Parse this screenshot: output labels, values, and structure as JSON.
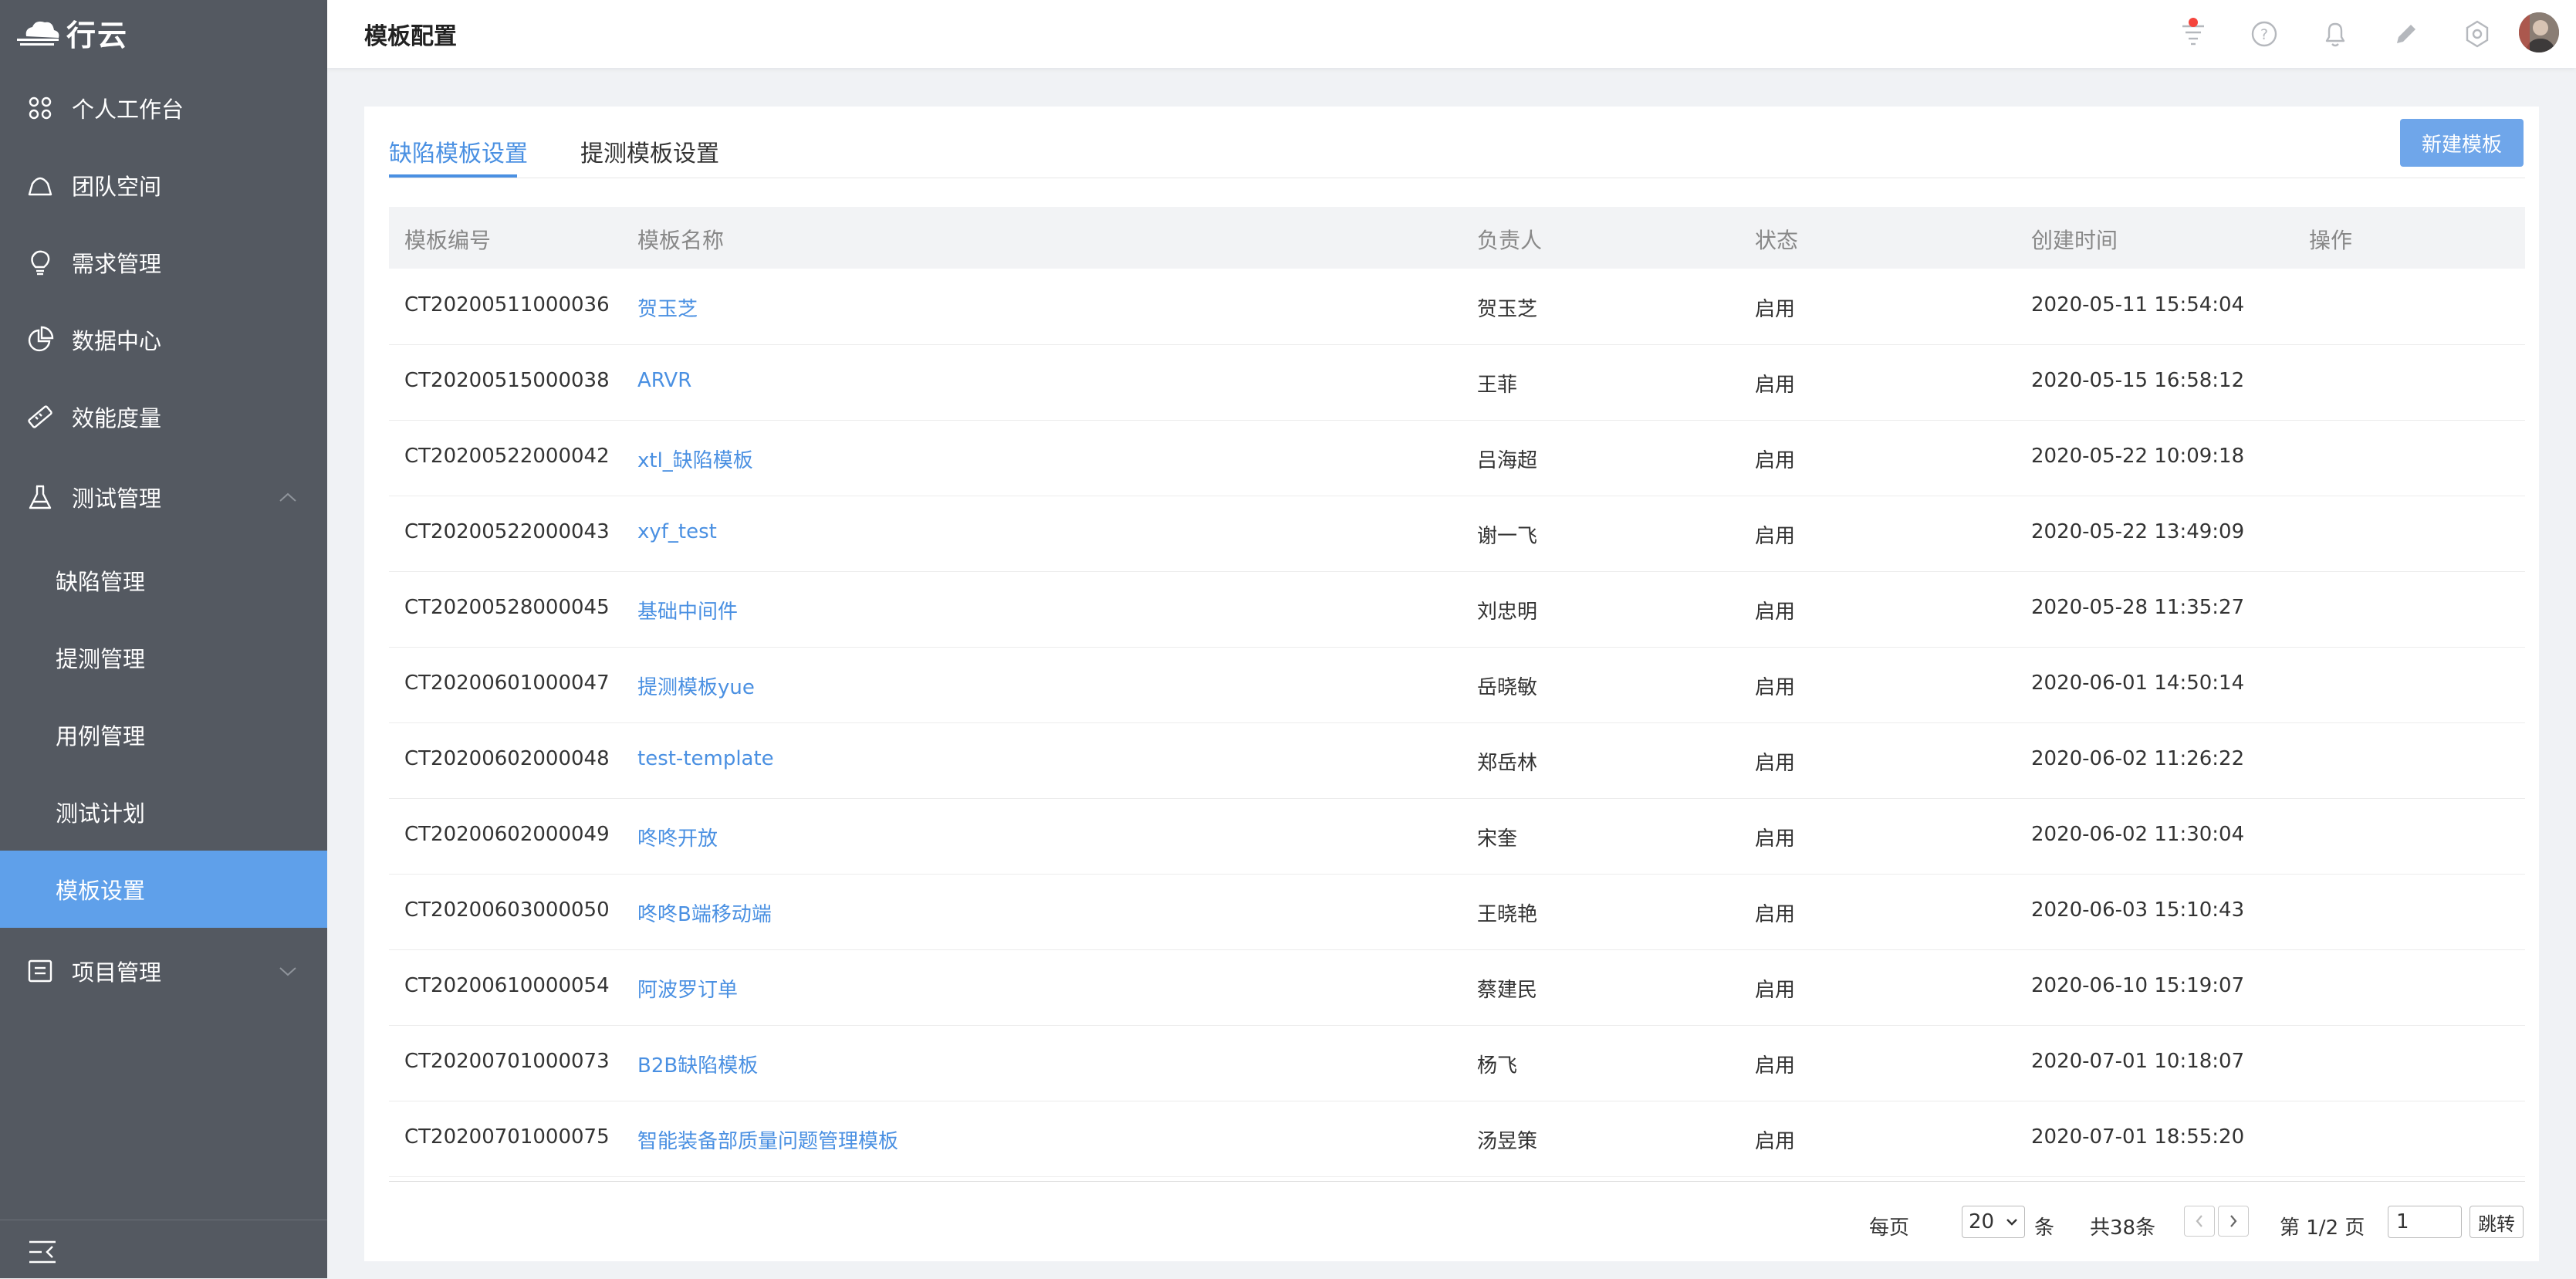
{
  "app": {
    "logo_text": "行云"
  },
  "sidebar": {
    "items": [
      {
        "label": "个人工作台",
        "icon": "grid-icon"
      },
      {
        "label": "团队空间",
        "icon": "team-icon"
      },
      {
        "label": "需求管理",
        "icon": "lightbulb-icon"
      },
      {
        "label": "数据中心",
        "icon": "pie-chart-icon"
      },
      {
        "label": "效能度量",
        "icon": "ruler-icon"
      },
      {
        "label": "测试管理",
        "icon": "flask-icon",
        "expanded": true
      },
      {
        "label": "项目管理",
        "icon": "list-icon",
        "expanded": false
      }
    ],
    "sub_items": [
      {
        "label": "缺陷管理"
      },
      {
        "label": "提测管理"
      },
      {
        "label": "用例管理"
      },
      {
        "label": "测试计划"
      },
      {
        "label": "模板设置",
        "active": true
      }
    ]
  },
  "header": {
    "title": "模板配置",
    "icons": [
      "filter-icon",
      "help-icon",
      "bell-icon",
      "pen-icon",
      "settings-icon",
      "avatar"
    ]
  },
  "tabs": [
    {
      "label": "缺陷模板设置",
      "active": true
    },
    {
      "label": "提测模板设置",
      "active": false
    }
  ],
  "new_button": "新建模板",
  "table": {
    "columns": [
      "模板编号",
      "模板名称",
      "负责人",
      "状态",
      "创建时间",
      "操作"
    ],
    "rows": [
      {
        "id": "CT20200511000036",
        "name": "贺玉芝",
        "owner": "贺玉芝",
        "status": "启用",
        "created": "2020-05-11 15:54:04"
      },
      {
        "id": "CT20200515000038",
        "name": "ARVR",
        "owner": "王菲",
        "status": "启用",
        "created": "2020-05-15 16:58:12"
      },
      {
        "id": "CT20200522000042",
        "name": "xtl_缺陷模板",
        "owner": "吕海超",
        "status": "启用",
        "created": "2020-05-22 10:09:18"
      },
      {
        "id": "CT20200522000043",
        "name": "xyf_test",
        "owner": "谢一飞",
        "status": "启用",
        "created": "2020-05-22 13:49:09"
      },
      {
        "id": "CT20200528000045",
        "name": "基础中间件",
        "owner": "刘忠明",
        "status": "启用",
        "created": "2020-05-28 11:35:27"
      },
      {
        "id": "CT20200601000047",
        "name": "提测模板yue",
        "owner": "岳晓敏",
        "status": "启用",
        "created": "2020-06-01 14:50:14"
      },
      {
        "id": "CT20200602000048",
        "name": "test-template",
        "owner": "郑岳林",
        "status": "启用",
        "created": "2020-06-02 11:26:22"
      },
      {
        "id": "CT20200602000049",
        "name": "咚咚开放",
        "owner": "宋奎",
        "status": "启用",
        "created": "2020-06-02 11:30:04"
      },
      {
        "id": "CT20200603000050",
        "name": "咚咚B端移动端",
        "owner": "王晓艳",
        "status": "启用",
        "created": "2020-06-03 15:10:43"
      },
      {
        "id": "CT20200610000054",
        "name": "阿波罗订单",
        "owner": "蔡建民",
        "status": "启用",
        "created": "2020-06-10 15:19:07"
      },
      {
        "id": "CT20200701000073",
        "name": "B2B缺陷模板",
        "owner": "杨飞",
        "status": "启用",
        "created": "2020-07-01 10:18:07"
      },
      {
        "id": "CT20200701000075",
        "name": "智能装备部质量问题管理模板",
        "owner": "汤昱策",
        "status": "启用",
        "created": "2020-07-01 18:55:20"
      }
    ]
  },
  "pagination": {
    "per_page_label": "每页",
    "per_page_value": "20",
    "per_page_unit": "条",
    "total": "共38条",
    "page_info": "第 1/2 页",
    "jump_value": "1",
    "jump_label": "跳转"
  },
  "colors": {
    "sidebar_bg": "#545961",
    "active_bg": "#5fa0ea",
    "accent": "#4a90e2",
    "button": "#6fa6ea"
  }
}
